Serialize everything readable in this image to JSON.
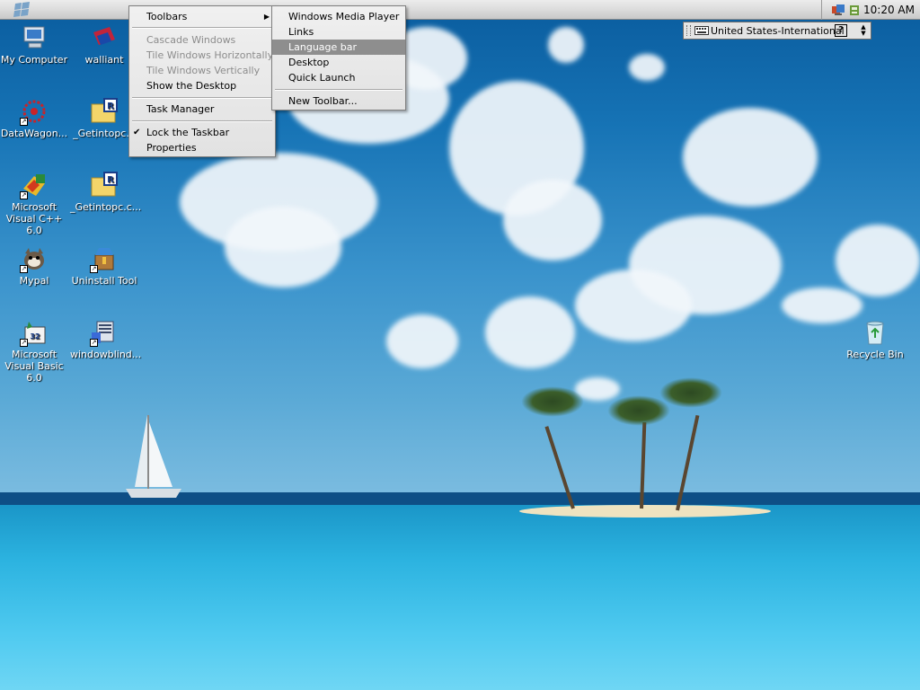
{
  "taskbar": {
    "clock": "10:20 AM",
    "tray_icons": [
      "network-icon",
      "speaker-icon"
    ]
  },
  "language_bar": {
    "language": "United States-International",
    "help_glyph": "?"
  },
  "context_menu": {
    "items": [
      {
        "label": "Toolbars",
        "state": "normal",
        "submenu": true
      },
      {
        "label": "Cascade Windows",
        "state": "disabled"
      },
      {
        "label": "Tile Windows Horizontally",
        "state": "disabled"
      },
      {
        "label": "Tile Windows Vertically",
        "state": "disabled"
      },
      {
        "label": "Show the Desktop",
        "state": "normal"
      },
      {
        "label": "Task Manager",
        "state": "normal"
      },
      {
        "label": "Lock the Taskbar",
        "state": "checked"
      },
      {
        "label": "Properties",
        "state": "normal"
      }
    ]
  },
  "toolbars_submenu": {
    "items": [
      {
        "label": "Windows Media Player"
      },
      {
        "label": "Links"
      },
      {
        "label": "Language bar",
        "highlighted": true
      },
      {
        "label": "Desktop"
      },
      {
        "label": "Quick Launch"
      },
      {
        "label": "New Toolbar..."
      }
    ]
  },
  "desktop_icons": [
    {
      "label": "My Computer",
      "icon": "computer-icon"
    },
    {
      "label": "walliant",
      "icon": "walliant-icon"
    },
    {
      "label": "DataWagon...",
      "icon": "datawagon-icon"
    },
    {
      "label": "_Getintopc...",
      "icon": "folder-icon"
    },
    {
      "label": "Microsoft Visual C++ 6.0",
      "icon": "visual-cpp-icon"
    },
    {
      "label": "_Getintopc.c...",
      "icon": "folder-icon"
    },
    {
      "label": "Mypal",
      "icon": "mypal-icon"
    },
    {
      "label": "Uninstall Tool",
      "icon": "uninstall-tool-icon"
    },
    {
      "label": "Microsoft Visual Basic 6.0",
      "icon": "visual-basic-icon"
    },
    {
      "label": "windowblind...",
      "icon": "windowblinds-icon"
    },
    {
      "label": "Recycle Bin",
      "icon": "recycle-bin-icon"
    }
  ]
}
